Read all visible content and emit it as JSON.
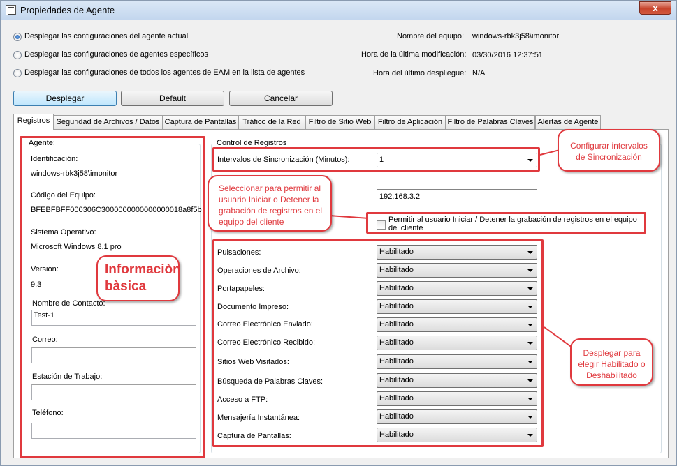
{
  "window": {
    "title": "Propiedades de Agente",
    "close_glyph": "x"
  },
  "options": [
    {
      "label": "Desplegar las configuraciones del agente actual",
      "checked": true
    },
    {
      "label": "Desplegar las configuraciones de agentes específicos",
      "checked": false
    },
    {
      "label": "Desplegar las configuraciones de todos los agentes de EAM en la lista de agentes",
      "checked": false
    }
  ],
  "info": {
    "computer_name_label": "Nombre del equipo:",
    "computer_name_value": "windows-rbk3j58\\imonitor",
    "last_mod_label": "Hora de la última modificación:",
    "last_mod_value": "03/30/2016 12:37:51",
    "last_deploy_label": "Hora del último despliegue:",
    "last_deploy_value": "N/A"
  },
  "buttons": {
    "deploy": "Desplegar",
    "default": "Default",
    "cancel": "Cancelar"
  },
  "tabs": [
    "Registros",
    "Seguridad de Archivos / Datos",
    "Captura de Pantallas",
    "Tráfico de la Red",
    "Filtro de Sitio Web",
    "Filtro de Aplicación",
    "Filtro de Palabras Claves",
    "Alertas de Agente"
  ],
  "agent": {
    "group_title": "Agente:",
    "id_label": "Identificación:",
    "id_value": "windows-rbk3j58\\imonitor",
    "code_label": "Código del Equipo:",
    "code_value": "BFEBFBFF000306C3000000000000000018a8f5b",
    "os_label": "Sistema Operativo:",
    "os_value": "Microsoft Windows 8.1 pro",
    "version_label": "Versión:",
    "version_value": "9.3",
    "contact_label": "Nombre de Contacto:",
    "contact_value": "Test-1",
    "email_label": "Correo:",
    "email_value": "",
    "workstation_label": "Estación de Trabajo:",
    "workstation_value": "",
    "phone_label": "Teléfono:",
    "phone_value": ""
  },
  "control": {
    "group_title": "Control de Registros",
    "sync_label": "Intervalos de Sincronización (Minutos):",
    "sync_value": "1",
    "ip_value": "192.168.3.2",
    "allow_label": "Permitir al usuario Iniciar / Detener la grabación de registros en el equipo del cliente",
    "allow_checked": false,
    "rows": [
      {
        "label": "Pulsaciones:",
        "value": "Habilitado"
      },
      {
        "label": "Operaciones de Archivo:",
        "value": "Habilitado"
      },
      {
        "label": "Portapapeles:",
        "value": "Habilitado"
      },
      {
        "label": "Documento Impreso:",
        "value": "Habilitado"
      },
      {
        "label": "Correo Electrónico Enviado:",
        "value": "Habilitado"
      },
      {
        "label": "Correo Electrónico Recibido:",
        "value": "Habilitado"
      },
      {
        "label": "Sitios Web Visitados:",
        "value": "Habilitado"
      },
      {
        "label": "Búsqueda de Palabras Claves:",
        "value": "Habilitado"
      },
      {
        "label": "Acceso a FTP:",
        "value": "Habilitado"
      },
      {
        "label": "Mensajería Instantánea:",
        "value": "Habilitado"
      },
      {
        "label": "Captura de Pantallas:",
        "value": "Habilitado"
      }
    ]
  },
  "annotations": {
    "basic_info": "Informaciòn bàsica",
    "sync_note": "Configurar intervalos de Sincronización",
    "allow_note": "Seleccionar para permitir al usuario Iniciar o Detener la grabación de registros en el equipo del cliente",
    "dropdown_note": "Desplegar para elegir Habilitado o Deshabilitado",
    "accent_color": "#e0393e"
  }
}
